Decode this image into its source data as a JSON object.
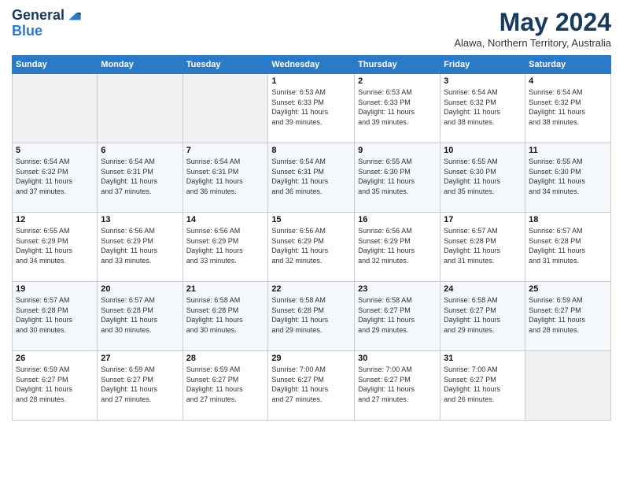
{
  "header": {
    "logo_line1": "General",
    "logo_line2": "Blue",
    "month": "May 2024",
    "location": "Alawa, Northern Territory, Australia"
  },
  "days_of_week": [
    "Sunday",
    "Monday",
    "Tuesday",
    "Wednesday",
    "Thursday",
    "Friday",
    "Saturday"
  ],
  "weeks": [
    [
      {
        "day": "",
        "info": ""
      },
      {
        "day": "",
        "info": ""
      },
      {
        "day": "",
        "info": ""
      },
      {
        "day": "1",
        "info": "Sunrise: 6:53 AM\nSunset: 6:33 PM\nDaylight: 11 hours\nand 39 minutes."
      },
      {
        "day": "2",
        "info": "Sunrise: 6:53 AM\nSunset: 6:33 PM\nDaylight: 11 hours\nand 39 minutes."
      },
      {
        "day": "3",
        "info": "Sunrise: 6:54 AM\nSunset: 6:32 PM\nDaylight: 11 hours\nand 38 minutes."
      },
      {
        "day": "4",
        "info": "Sunrise: 6:54 AM\nSunset: 6:32 PM\nDaylight: 11 hours\nand 38 minutes."
      }
    ],
    [
      {
        "day": "5",
        "info": "Sunrise: 6:54 AM\nSunset: 6:32 PM\nDaylight: 11 hours\nand 37 minutes."
      },
      {
        "day": "6",
        "info": "Sunrise: 6:54 AM\nSunset: 6:31 PM\nDaylight: 11 hours\nand 37 minutes."
      },
      {
        "day": "7",
        "info": "Sunrise: 6:54 AM\nSunset: 6:31 PM\nDaylight: 11 hours\nand 36 minutes."
      },
      {
        "day": "8",
        "info": "Sunrise: 6:54 AM\nSunset: 6:31 PM\nDaylight: 11 hours\nand 36 minutes."
      },
      {
        "day": "9",
        "info": "Sunrise: 6:55 AM\nSunset: 6:30 PM\nDaylight: 11 hours\nand 35 minutes."
      },
      {
        "day": "10",
        "info": "Sunrise: 6:55 AM\nSunset: 6:30 PM\nDaylight: 11 hours\nand 35 minutes."
      },
      {
        "day": "11",
        "info": "Sunrise: 6:55 AM\nSunset: 6:30 PM\nDaylight: 11 hours\nand 34 minutes."
      }
    ],
    [
      {
        "day": "12",
        "info": "Sunrise: 6:55 AM\nSunset: 6:29 PM\nDaylight: 11 hours\nand 34 minutes."
      },
      {
        "day": "13",
        "info": "Sunrise: 6:56 AM\nSunset: 6:29 PM\nDaylight: 11 hours\nand 33 minutes."
      },
      {
        "day": "14",
        "info": "Sunrise: 6:56 AM\nSunset: 6:29 PM\nDaylight: 11 hours\nand 33 minutes."
      },
      {
        "day": "15",
        "info": "Sunrise: 6:56 AM\nSunset: 6:29 PM\nDaylight: 11 hours\nand 32 minutes."
      },
      {
        "day": "16",
        "info": "Sunrise: 6:56 AM\nSunset: 6:29 PM\nDaylight: 11 hours\nand 32 minutes."
      },
      {
        "day": "17",
        "info": "Sunrise: 6:57 AM\nSunset: 6:28 PM\nDaylight: 11 hours\nand 31 minutes."
      },
      {
        "day": "18",
        "info": "Sunrise: 6:57 AM\nSunset: 6:28 PM\nDaylight: 11 hours\nand 31 minutes."
      }
    ],
    [
      {
        "day": "19",
        "info": "Sunrise: 6:57 AM\nSunset: 6:28 PM\nDaylight: 11 hours\nand 30 minutes."
      },
      {
        "day": "20",
        "info": "Sunrise: 6:57 AM\nSunset: 6:28 PM\nDaylight: 11 hours\nand 30 minutes."
      },
      {
        "day": "21",
        "info": "Sunrise: 6:58 AM\nSunset: 6:28 PM\nDaylight: 11 hours\nand 30 minutes."
      },
      {
        "day": "22",
        "info": "Sunrise: 6:58 AM\nSunset: 6:28 PM\nDaylight: 11 hours\nand 29 minutes."
      },
      {
        "day": "23",
        "info": "Sunrise: 6:58 AM\nSunset: 6:27 PM\nDaylight: 11 hours\nand 29 minutes."
      },
      {
        "day": "24",
        "info": "Sunrise: 6:58 AM\nSunset: 6:27 PM\nDaylight: 11 hours\nand 29 minutes."
      },
      {
        "day": "25",
        "info": "Sunrise: 6:59 AM\nSunset: 6:27 PM\nDaylight: 11 hours\nand 28 minutes."
      }
    ],
    [
      {
        "day": "26",
        "info": "Sunrise: 6:59 AM\nSunset: 6:27 PM\nDaylight: 11 hours\nand 28 minutes."
      },
      {
        "day": "27",
        "info": "Sunrise: 6:59 AM\nSunset: 6:27 PM\nDaylight: 11 hours\nand 27 minutes."
      },
      {
        "day": "28",
        "info": "Sunrise: 6:59 AM\nSunset: 6:27 PM\nDaylight: 11 hours\nand 27 minutes."
      },
      {
        "day": "29",
        "info": "Sunrise: 7:00 AM\nSunset: 6:27 PM\nDaylight: 11 hours\nand 27 minutes."
      },
      {
        "day": "30",
        "info": "Sunrise: 7:00 AM\nSunset: 6:27 PM\nDaylight: 11 hours\nand 27 minutes."
      },
      {
        "day": "31",
        "info": "Sunrise: 7:00 AM\nSunset: 6:27 PM\nDaylight: 11 hours\nand 26 minutes."
      },
      {
        "day": "",
        "info": ""
      }
    ]
  ]
}
